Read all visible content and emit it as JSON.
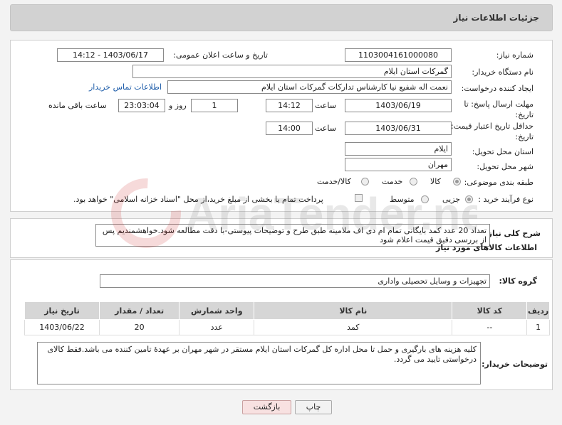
{
  "page": {
    "title": "جزئیات اطلاعات نیاز"
  },
  "form": {
    "need_number_label": "شماره نیاز:",
    "need_number": "1103004161000080",
    "announce_label": "تاریخ و ساعت اعلان عمومی:",
    "announce_value": "1403/06/17 - 14:12",
    "buyer_org_label": "نام دستگاه خریدار:",
    "buyer_org": "گمرکات استان ایلام",
    "requester_label": "ایجاد کننده درخواست:",
    "requester": "نعمت اله شفیع نیا کارشناس تدارکات گمرکات استان ایلام",
    "contact_link": "اطلاعات تماس خریدار",
    "deadline_label": "مهلت ارسال پاسخ: تا تاریخ:",
    "deadline_date": "1403/06/19",
    "time_label": "ساعت",
    "deadline_time": "14:12",
    "days_value": "1",
    "days_label": "روز و",
    "remaining_time": "23:03:04",
    "remaining_label": "ساعت باقی مانده",
    "validity_label": "حداقل تاریخ اعتبار قیمت: تا تاریخ:",
    "validity_date": "1403/06/31",
    "validity_time": "14:00",
    "province_label": "استان محل تحویل:",
    "province": "ایلام",
    "city_label": "شهر محل تحویل:",
    "city": "مهران",
    "category_label": "طبقه بندی موضوعی:",
    "category_options": [
      "کالا",
      "خدمت",
      "کالا/خدمت"
    ],
    "purchase_type_label": "نوع فرآیند خرید :",
    "purchase_options": [
      "جزیی",
      "متوسط"
    ],
    "payment_note": "پرداخت تمام یا بخشی از مبلغ خرید،از محل \"اسناد خزانه اسلامی\" خواهد بود."
  },
  "description": {
    "label": "شرح کلی نیاز:",
    "text": "تعداد 20 عدد کمد بایگانی تمام ام دی اف ملامینه طبق طرح و توضیحات پیوستی-با دقت مطالعه شود.خواهشمندیم پس از بررسی دقیق قیمت اعلام شود"
  },
  "goods": {
    "section_title": "اطلاعات کالاهای مورد نیاز",
    "group_label": "گروه کالا:",
    "group_value": "تجهیزات و وسایل تحصیلی واداری",
    "columns": [
      "ردیف",
      "کد کالا",
      "نام کالا",
      "واحد شمارش",
      "تعداد / مقدار",
      "تاریخ نیاز"
    ],
    "rows": [
      {
        "row": "1",
        "code": "--",
        "name": "کمد",
        "unit": "عدد",
        "qty": "20",
        "date": "1403/06/22"
      }
    ]
  },
  "buyer_notes": {
    "label": "توضیحات خریدار:",
    "text": "کلیه هزینه های  بارگیری و حمل تا محل اداره کل گمرکات استان ایلام مستقر در شهر مهران بر عهدهٔ تامین کننده می باشد.فقط کالای درخواستی تایید می گردد."
  },
  "buttons": {
    "print": "چاپ",
    "back": "بازگشت"
  },
  "watermark": {
    "brand_text": "AriaTender.net"
  },
  "colors": {
    "header_bg": "#d2d2d2",
    "link": "#1a5aa8",
    "back_button": "#f8e1e1"
  }
}
